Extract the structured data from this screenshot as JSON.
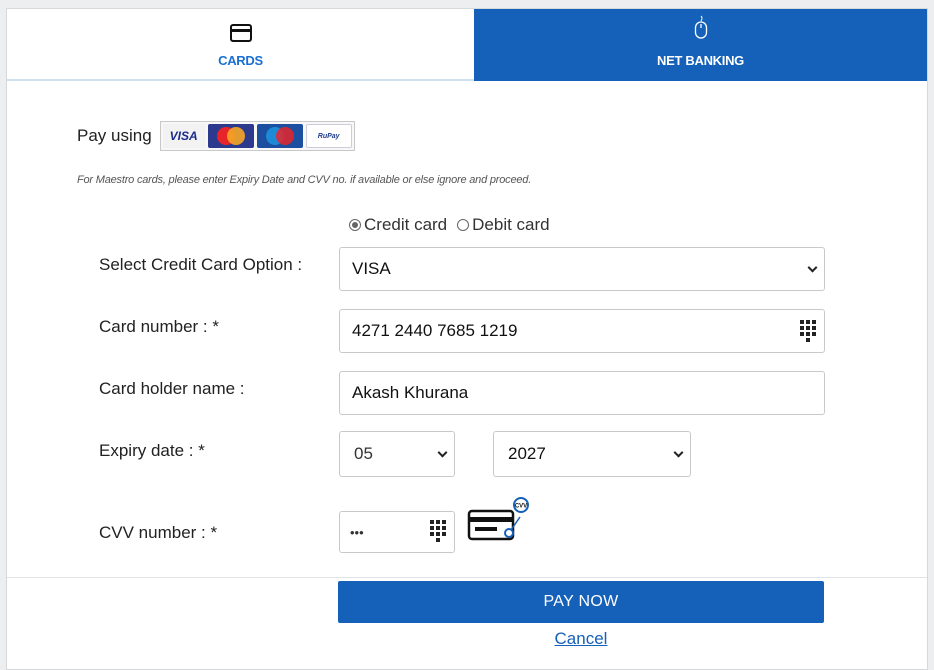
{
  "tabs": {
    "cards": {
      "label": "CARDS",
      "icon": "credit-card-icon"
    },
    "net_banking": {
      "label": "NET BANKING",
      "icon": "mouse-icon"
    }
  },
  "pay_using": {
    "label": "Pay using",
    "logos": {
      "visa": "VISA",
      "rupay": "RuPay"
    }
  },
  "note": "For Maestro cards, please enter Expiry Date and CVV no. if available or else ignore and proceed.",
  "card_type": {
    "options": [
      "Credit card",
      "Debit card"
    ],
    "selected": "Credit card"
  },
  "form": {
    "card_option": {
      "label": "Select Credit Card Option :",
      "value": "VISA"
    },
    "card_number": {
      "label": "Card number : *",
      "value": "4271 2440 7685 1219"
    },
    "holder_name": {
      "label": "Card holder name :",
      "value": "Akash Khurana"
    },
    "expiry": {
      "label": "Expiry date : *",
      "month": "05",
      "year": "2027"
    },
    "cvv": {
      "label": "CVV number : *",
      "value": "•••"
    }
  },
  "actions": {
    "pay_now": "PAY NOW",
    "cancel": "Cancel"
  },
  "colors": {
    "primary": "#1560b8",
    "tab_active_text": "#1a6fd0"
  }
}
